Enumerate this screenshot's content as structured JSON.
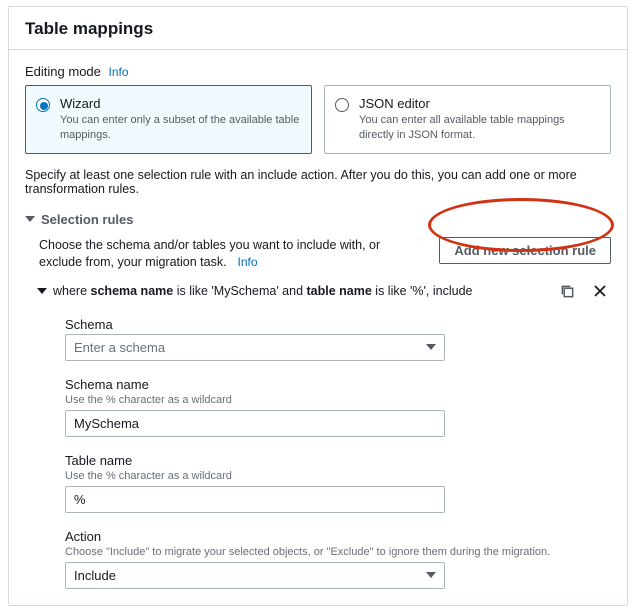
{
  "panel": {
    "title": "Table mappings"
  },
  "editing_mode": {
    "label": "Editing mode",
    "info": "Info",
    "options": [
      {
        "title": "Wizard",
        "desc": "You can enter only a subset of the available table mappings.",
        "selected": true
      },
      {
        "title": "JSON editor",
        "desc": "You can enter all available table mappings directly in JSON format.",
        "selected": false
      }
    ]
  },
  "instruction": "Specify at least one selection rule with an include action. After you do this, you can add one or more transformation rules.",
  "selection_rules": {
    "header": "Selection rules",
    "desc": "Choose the schema and/or tables you want to include with, or exclude from, your migration task.",
    "info": "Info",
    "add_button": "Add new selection rule",
    "rule": {
      "summary_parts": {
        "p1": "where ",
        "b1": "schema name",
        "p2": " is like 'MySchema' and ",
        "b2": "table name",
        "p3": " is like '%', include"
      },
      "fields": {
        "schema": {
          "label": "Schema",
          "placeholder": "Enter a schema"
        },
        "schema_name": {
          "label": "Schema name",
          "hint": "Use the % character as a wildcard",
          "value": "MySchema"
        },
        "table_name": {
          "label": "Table name",
          "hint": "Use the % character as a wildcard",
          "value": "%"
        },
        "action": {
          "label": "Action",
          "hint": "Choose \"Include\" to migrate your selected objects, or \"Exclude\" to ignore them during the migration.",
          "value": "Include"
        }
      }
    }
  }
}
